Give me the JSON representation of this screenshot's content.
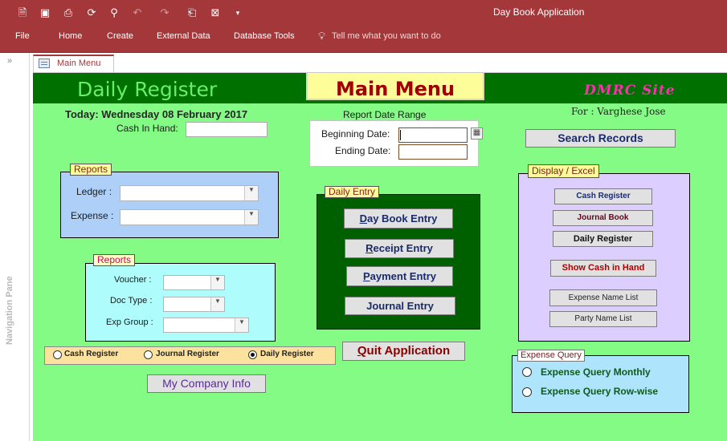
{
  "window": {
    "title": "Day Book Application"
  },
  "quick_access_icons": [
    "new-file-icon",
    "save-icon",
    "print-preview-icon",
    "sync-icon",
    "search-icon",
    "undo-icon",
    "redo-icon",
    "clipboard-icon",
    "excel-icon",
    "customize-icon"
  ],
  "ribbon": {
    "items": [
      "File",
      "Home",
      "Create",
      "External Data",
      "Database Tools"
    ],
    "tell_me": "Tell me what you want to do"
  },
  "nav_pane": {
    "label": "Navigation Pane",
    "toggle": "»"
  },
  "tab": {
    "label": "Main Menu"
  },
  "form": {
    "header_title": "Daily Register",
    "main_menu": "Main Menu",
    "site": "DMRC Site",
    "today": "Today: Wednesday 08 February 2017",
    "cash_in_hand_label": "Cash In Hand:",
    "for_label": "For : Varghese Jose",
    "report_date_range": {
      "title": "Report Date Range",
      "beginning_label": "Beginning Date:",
      "ending_label": "Ending Date:"
    },
    "reports1": {
      "label": "Reports",
      "ledger": "Ledger :",
      "expense": "Expense :"
    },
    "reports2": {
      "label": "Reports",
      "voucher": "Voucher :",
      "doc_type": "Doc Type :",
      "exp_group": "Exp Group :"
    },
    "daily_entry": {
      "label": "Daily Entry",
      "buttons": [
        {
          "first": "D",
          "rest": "ay Book Entry"
        },
        {
          "first": "R",
          "rest": "eceipt Entry"
        },
        {
          "first": "P",
          "rest": "ayment Entry"
        },
        {
          "first": "",
          "rest": "Journal Entry"
        }
      ]
    },
    "display_excel": {
      "label": "Display / Excel",
      "cash_register": "Cash Register",
      "journal_book": "Journal Book",
      "daily_register": "Daily Register",
      "show_cash": "Show Cash in Hand",
      "expense_name_list": "Expense Name List",
      "party_name_list": "Party Name List"
    },
    "search_records": "Search Records",
    "quit": {
      "first": "Q",
      "rest": "uit Application"
    },
    "my_company": "My Company Info",
    "radio": {
      "cash": "Cash Register",
      "journal": "Journal Register",
      "daily": "Daily Register",
      "selected": "Daily Register"
    },
    "expense_query": {
      "label": "Expense Query",
      "monthly": "Expense Query Monthly",
      "rowwise": "Expense Query Row-wise"
    }
  },
  "colors": {
    "accent": "#a4373a",
    "form_bg": "#84fb84",
    "header_bg": "#007000",
    "daily_entry_bg": "#006000"
  }
}
